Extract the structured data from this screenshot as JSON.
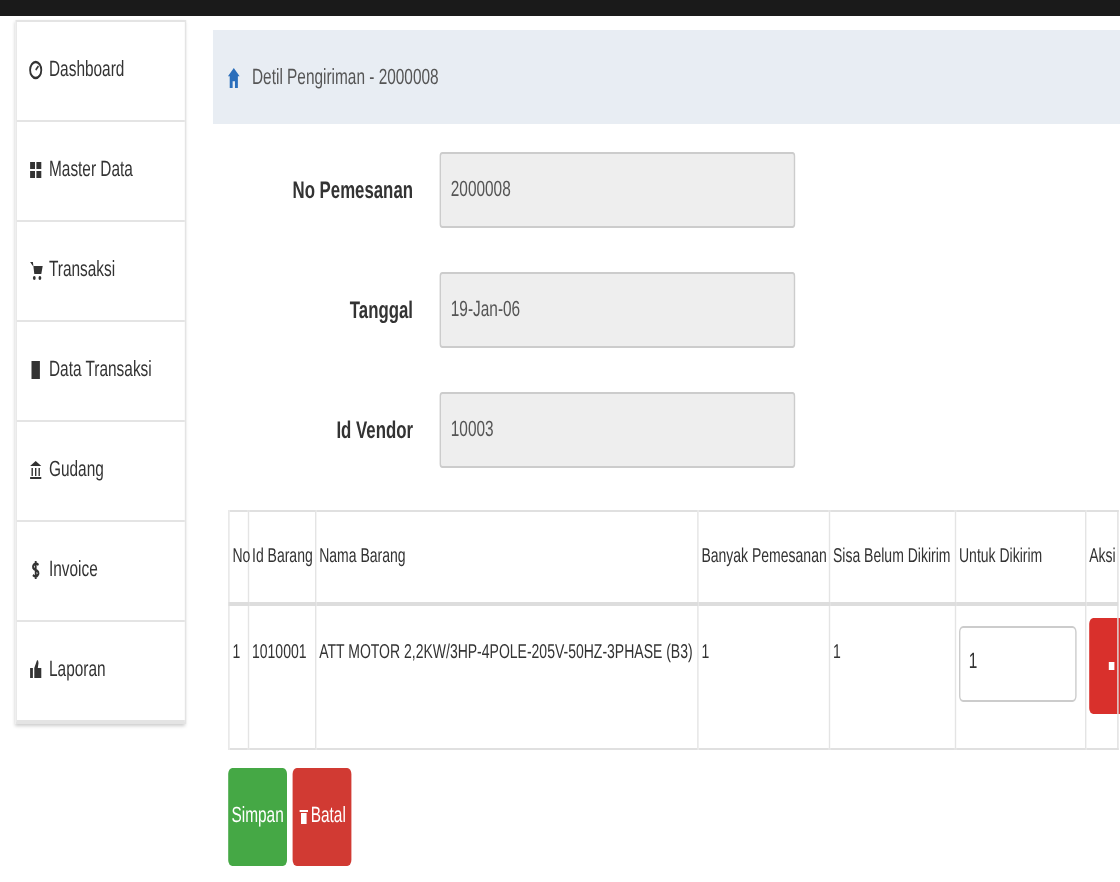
{
  "sidebar": {
    "items": [
      {
        "kind": "dashboard",
        "label": "Dashboard"
      },
      {
        "kind": "grid",
        "label": "Master Data"
      },
      {
        "kind": "cart",
        "label": "Transaksi"
      },
      {
        "kind": "file",
        "label": "Data Transaksi"
      },
      {
        "kind": "bank",
        "label": "Gudang"
      },
      {
        "kind": "dollar",
        "label": "Invoice"
      },
      {
        "kind": "thumb",
        "label": "Laporan"
      }
    ]
  },
  "breadcrumb": "Detil Pengiriman - 2000008",
  "form": [
    {
      "label": "No Pemesanan",
      "value": "2000008"
    },
    {
      "label": "Tanggal",
      "value": "19-Jan-06"
    },
    {
      "label": "Id Vendor",
      "value": "10003"
    }
  ],
  "table": {
    "columns": [
      "No",
      "Id Barang",
      "Nama Barang",
      "Banyak Pemesanan",
      "Sisa Belum Dikirim",
      "Untuk Dikirim",
      "Aksi"
    ],
    "rows": [
      {
        "no": "1",
        "id": "1010001",
        "name": "ATT MOTOR 2,2KW/3HP-4POLE-205V-50HZ-3PHASE (B3)",
        "qty": "1",
        "remaining": "1",
        "to_send": "1"
      }
    ]
  },
  "buttons": [
    {
      "kind": "save",
      "label": "Simpan"
    },
    {
      "kind": "cancel",
      "label": "Batal"
    }
  ]
}
